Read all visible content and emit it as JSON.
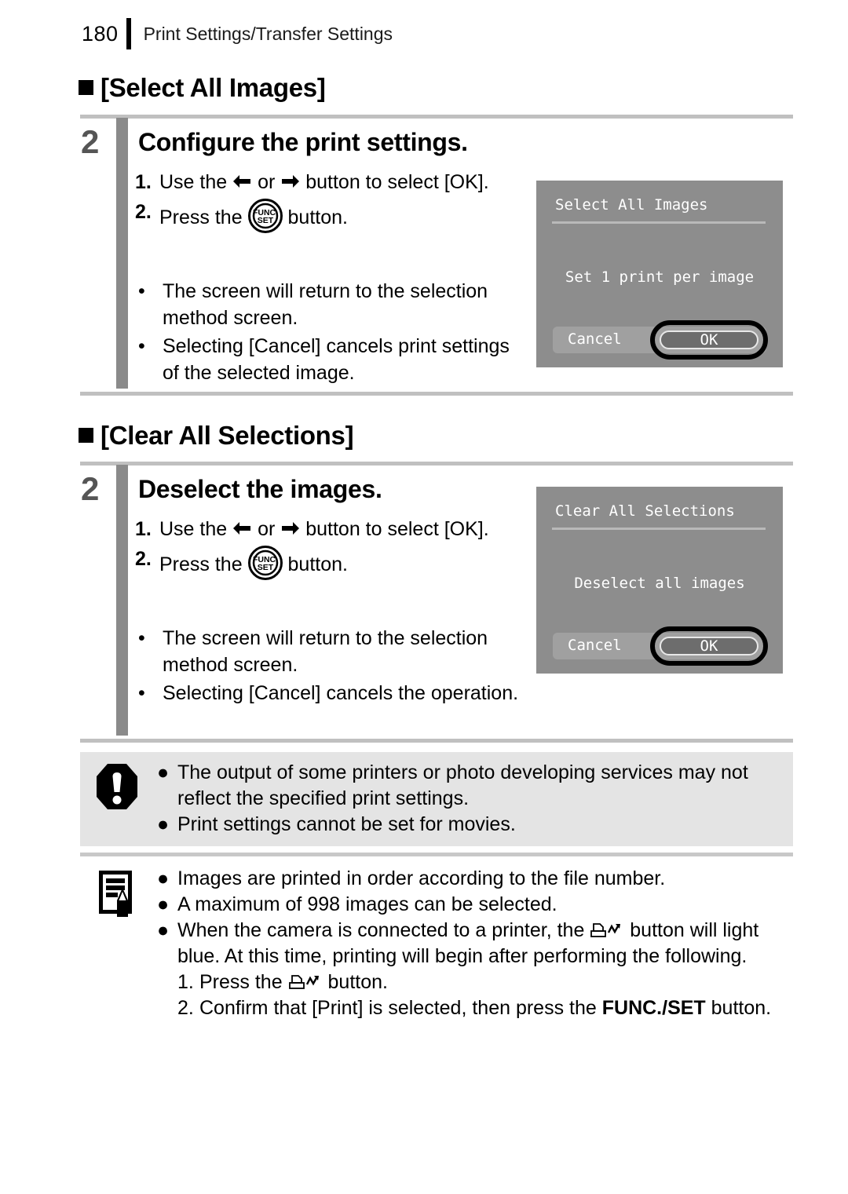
{
  "header": {
    "page_number": "180",
    "title": "Print Settings/Transfer Settings"
  },
  "sections": [
    {
      "heading": "[Select All Images]",
      "step_number": "2",
      "step_title": "Configure the print settings.",
      "instructions": [
        {
          "marker": "1.",
          "text_before": "Use the",
          "text_mid": "or",
          "text_after": "button to select [OK]."
        },
        {
          "marker": "2.",
          "text_before": "Press the",
          "text_after": "button."
        }
      ],
      "bullets": [
        "The screen will return to the selection method screen.",
        "Selecting [Cancel] cancels print settings of the selected image."
      ],
      "screen": {
        "title": "Select All Images",
        "message": "Set 1 print per image",
        "cancel_label": "Cancel",
        "ok_label": "OK"
      }
    },
    {
      "heading": "[Clear All Selections]",
      "step_number": "2",
      "step_title": "Deselect the images.",
      "instructions": [
        {
          "marker": "1.",
          "text_before": "Use the",
          "text_mid": "or",
          "text_after": "button to select [OK]."
        },
        {
          "marker": "2.",
          "text_before": "Press the",
          "text_after": "button."
        }
      ],
      "bullets": [
        "The screen will return to the selection method screen.",
        "Selecting [Cancel] cancels the operation."
      ],
      "screen": {
        "title": "Clear All Selections",
        "message": "Deselect all images",
        "cancel_label": "Cancel",
        "ok_label": "OK"
      }
    }
  ],
  "warning": {
    "icon": "exclamation-octagon-icon",
    "bullets": [
      "The output of some printers or photo developing services may not reflect the specified print settings.",
      "Print settings cannot be set for movies."
    ]
  },
  "note": {
    "icon": "note-pencil-icon",
    "bullets": [
      "Images are printed in order according to the file number.",
      "A maximum of 998 images can be selected."
    ],
    "third_bullet": {
      "part1": "When the camera is connected to a printer, the",
      "part2": "button will light blue. At this time, printing will begin after performing the following."
    },
    "sub_steps": [
      {
        "marker": "1.",
        "part1": "Press the",
        "part2": "button."
      },
      {
        "marker": "2.",
        "part1": "Confirm that [Print] is selected, then press the",
        "bold": "FUNC./SET",
        "part2": "button."
      }
    ]
  },
  "colors": {
    "step_bar": "#8a8a8a",
    "step_number": "#555555",
    "rule": "#c0c0c0",
    "lcd_background": "#8d8d8d",
    "warning_background": "#e4e4e4"
  }
}
